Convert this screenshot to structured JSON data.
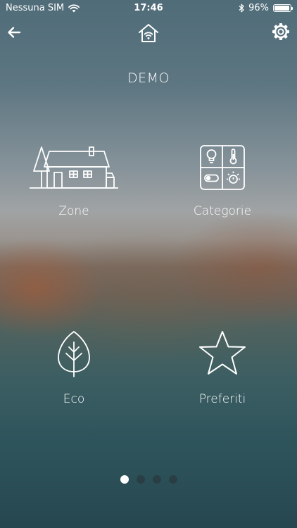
{
  "status_bar": {
    "carrier": "Nessuna SIM",
    "time": "17:46",
    "battery_percent": "96%",
    "battery_level": 0.96,
    "icons": [
      "wifi-icon",
      "bluetooth-icon",
      "battery-icon"
    ]
  },
  "nav": {
    "back_icon": "back-arrow-icon",
    "center_icon": "smart-home-icon",
    "settings_icon": "gear-icon"
  },
  "title": "DEMO",
  "tiles": [
    {
      "label": "Zone",
      "icon": "house-icon"
    },
    {
      "label": "Categorie",
      "icon": "categories-grid-icon"
    },
    {
      "label": "Eco",
      "icon": "leaf-icon"
    },
    {
      "label": "Preferiti",
      "icon": "star-icon"
    }
  ],
  "pager": {
    "pages": 4,
    "active_index": 0
  },
  "colors": {
    "foreground": "#ffffff",
    "dot_inactive": "#283237"
  }
}
